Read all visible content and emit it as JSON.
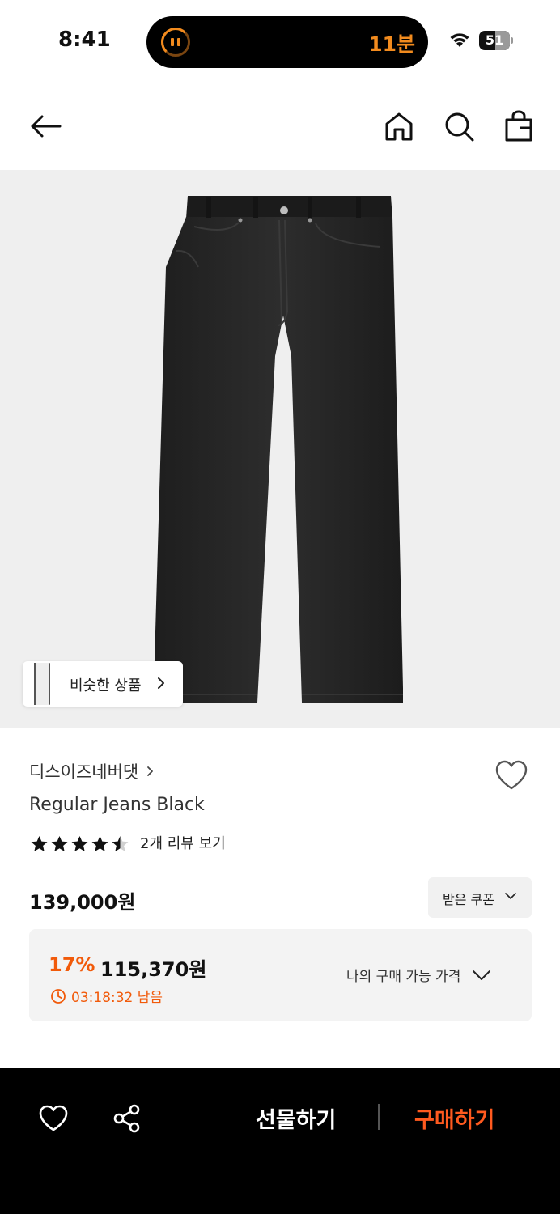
{
  "status_bar": {
    "time": "8:41",
    "activity_timer": "11분",
    "battery_level": "51",
    "accent_color": "#f28b1e"
  },
  "nav": {
    "back_icon": "arrow-left-icon",
    "home_icon": "home-icon",
    "search_icon": "search-icon",
    "bag_icon": "shopping-bag-icon"
  },
  "product_image": {
    "similar_products_label": "비슷한 상품"
  },
  "product": {
    "brand": "디스이즈네버댓",
    "name": "Regular Jeans Black",
    "rating": 4.5,
    "review_link": "2개 리뷰 보기",
    "price": "139,000원",
    "coupon_label": "받은 쿠폰"
  },
  "discount": {
    "rate": "17%",
    "price": "115,370원",
    "time_left": "03:18:32 남음",
    "my_price_label": "나의 구매 가능 가격",
    "accent_color": "#f15a0a"
  },
  "bottom_bar": {
    "gift_label": "선물하기",
    "buy_label": "구매하기",
    "buy_color": "#ff5a1f"
  }
}
